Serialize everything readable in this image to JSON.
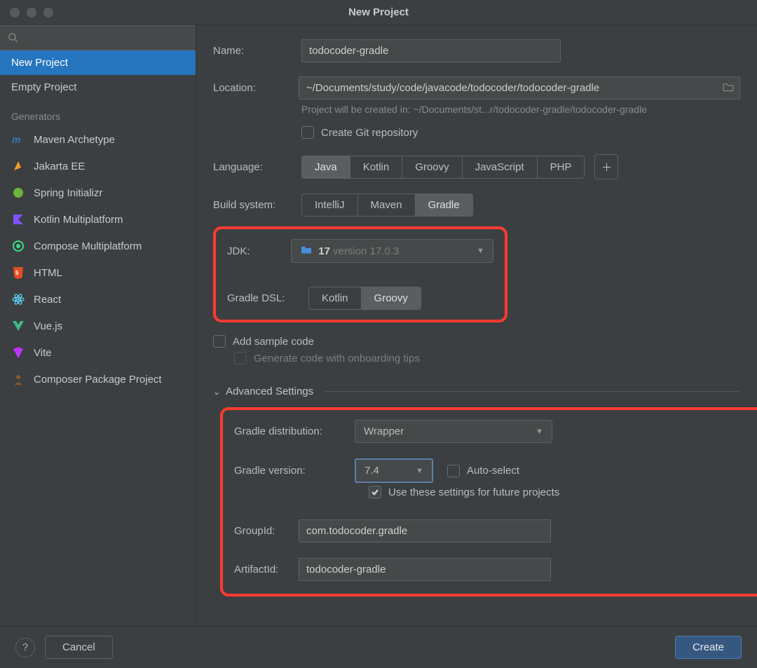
{
  "title": "New Project",
  "sidebar": {
    "top": [
      {
        "label": "New Project"
      },
      {
        "label": "Empty Project"
      }
    ],
    "gen_header": "Generators",
    "generators": [
      {
        "label": "Maven Archetype",
        "icon": "maven",
        "color": "#3178c6"
      },
      {
        "label": "Jakarta EE",
        "icon": "jakarta",
        "color": "#f0a020"
      },
      {
        "label": "Spring Initializr",
        "icon": "spring",
        "color": "#6db33f"
      },
      {
        "label": "Kotlin Multiplatform",
        "icon": "kotlin",
        "color": "#7f52ff"
      },
      {
        "label": "Compose Multiplatform",
        "icon": "compose",
        "color": "#3ddc84"
      },
      {
        "label": "HTML",
        "icon": "html",
        "color": "#e44d26"
      },
      {
        "label": "React",
        "icon": "react",
        "color": "#61dafb"
      },
      {
        "label": "Vue.js",
        "icon": "vue",
        "color": "#42b883"
      },
      {
        "label": "Vite",
        "icon": "vite",
        "color": "#bd34fe"
      },
      {
        "label": "Composer Package Project",
        "icon": "composer",
        "color": "#8b5a2b"
      }
    ]
  },
  "form": {
    "name_label": "Name:",
    "name_value": "todocoder-gradle",
    "location_label": "Location:",
    "location_value": "~/Documents/study/code/javacode/todocoder/todocoder-gradle",
    "location_hint": "Project will be created in: ~/Documents/st...r/todocoder-gradle/todocoder-gradle",
    "git_label": "Create Git repository",
    "lang_label": "Language:",
    "lang_options": [
      "Java",
      "Kotlin",
      "Groovy",
      "JavaScript",
      "PHP"
    ],
    "lang_selected": "Java",
    "build_label": "Build system:",
    "build_options": [
      "IntelliJ",
      "Maven",
      "Gradle"
    ],
    "build_selected": "Gradle",
    "jdk_label": "JDK:",
    "jdk_value_prefix": "17",
    "jdk_value_suffix": "version 17.0.3",
    "dsl_label": "Gradle DSL:",
    "dsl_options": [
      "Kotlin",
      "Groovy"
    ],
    "dsl_selected": "Groovy",
    "sample_label": "Add sample code",
    "onboarding_label": "Generate code with onboarding tips",
    "adv_header": "Advanced Settings",
    "adv": {
      "dist_label": "Gradle distribution:",
      "dist_value": "Wrapper",
      "ver_label": "Gradle version:",
      "ver_value": "7.4",
      "auto_select": "Auto-select",
      "future": "Use these settings for future projects",
      "group_label": "GroupId:",
      "group_value": "com.todocoder.gradle",
      "artifact_label": "ArtifactId:",
      "artifact_value": "todocoder-gradle"
    }
  },
  "footer": {
    "cancel": "Cancel",
    "create": "Create"
  }
}
